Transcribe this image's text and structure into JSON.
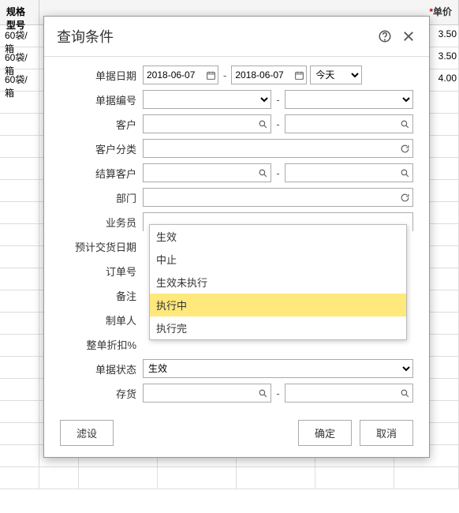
{
  "bg": {
    "header_spec": "规格型号",
    "header_price": "单价",
    "rows": [
      {
        "spec": "60袋/箱",
        "price": "3.50"
      },
      {
        "spec": "60袋/箱",
        "price": "3.50"
      },
      {
        "spec": "60袋/箱",
        "price": "4.00"
      }
    ]
  },
  "modal": {
    "title": "查询条件",
    "labels": {
      "bill_date": "单据日期",
      "bill_no": "单据编号",
      "customer": "客户",
      "customer_cat": "客户分类",
      "settle_customer": "结算客户",
      "department": "部门",
      "salesman": "业务员",
      "expected_date": "预计交货日期",
      "order_no": "订单号",
      "remark": "备注",
      "creator": "制单人",
      "discount": "整单折扣%",
      "status": "单据状态",
      "inventory": "存货"
    },
    "date_from": "2018-06-07",
    "date_to": "2018-06-07",
    "date_range_option": "今天",
    "status_value": "生效",
    "dropdown_options": [
      "生效",
      "中止",
      "生效未执行",
      "执行中",
      "执行完"
    ],
    "highlighted_index": 3,
    "buttons": {
      "filter": "滤设",
      "ok": "确定",
      "cancel": "取消"
    }
  }
}
